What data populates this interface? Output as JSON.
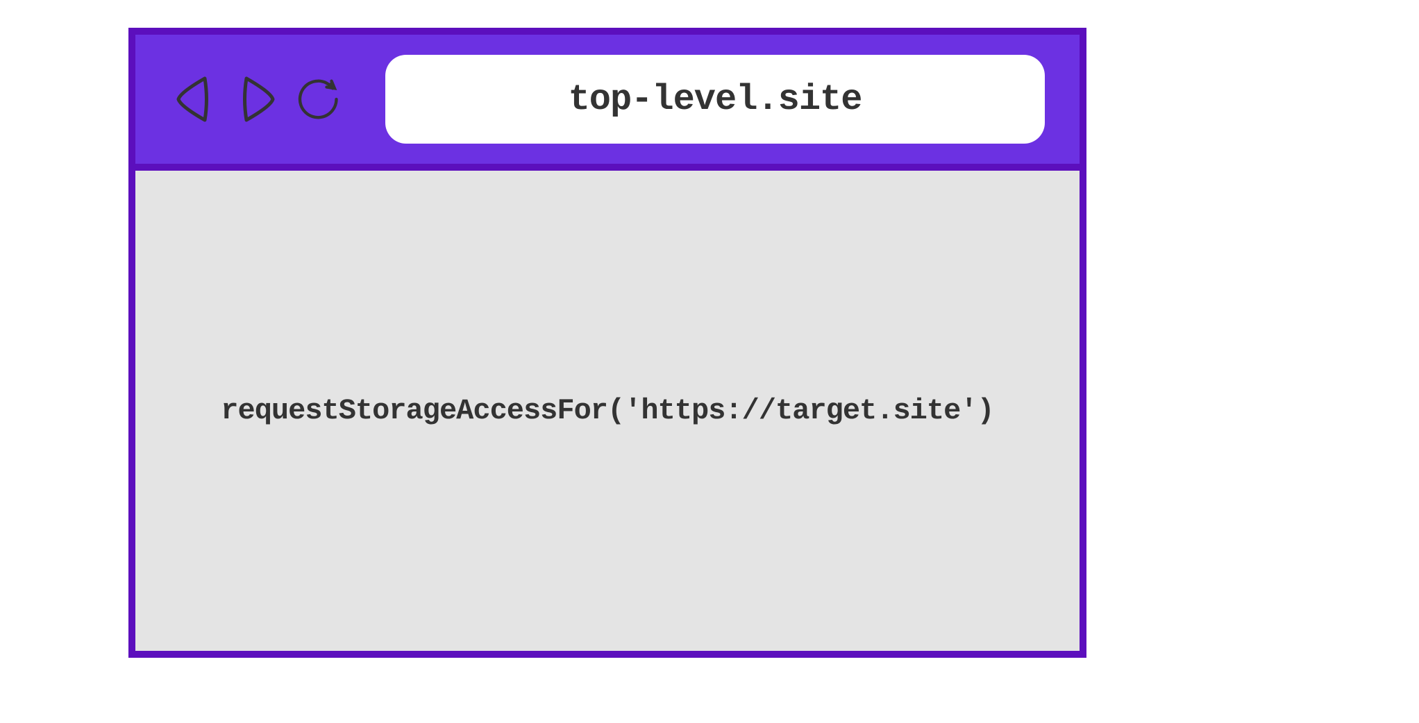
{
  "browser": {
    "address": "top-level.site",
    "content": {
      "code": "requestStorageAccessFor('https://target.site')"
    }
  },
  "colors": {
    "toolbar": "#6c31e2",
    "border": "#5c0fbd",
    "content_bg": "#e4e4e4",
    "text": "#333333",
    "address_bg": "#ffffff"
  }
}
